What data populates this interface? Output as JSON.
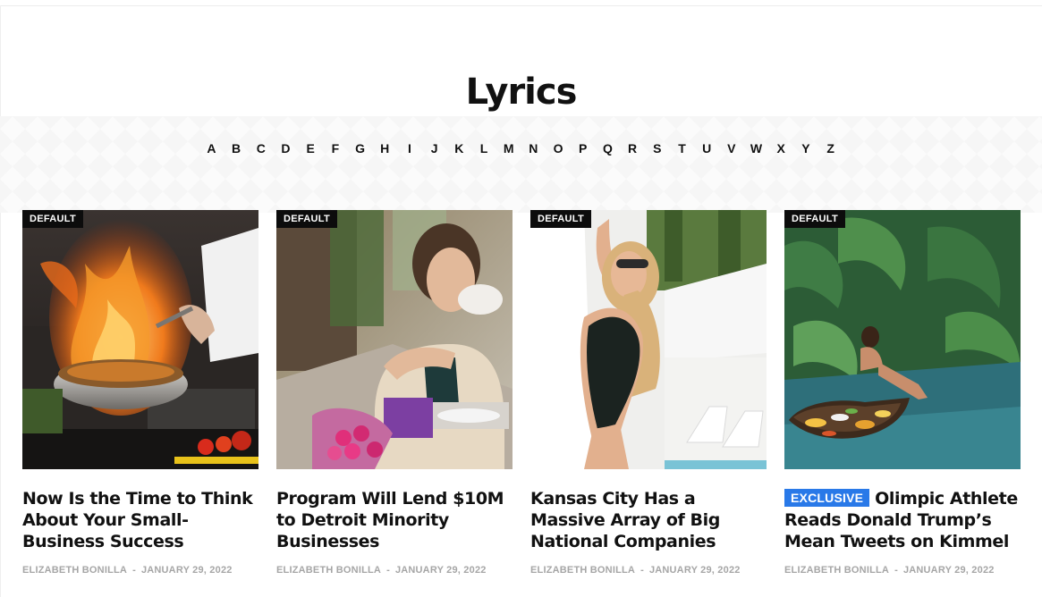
{
  "page": {
    "title": "Lyrics"
  },
  "alphabet": [
    "A",
    "B",
    "C",
    "D",
    "E",
    "F",
    "G",
    "H",
    "I",
    "J",
    "K",
    "L",
    "M",
    "N",
    "O",
    "P",
    "Q",
    "R",
    "S",
    "T",
    "U",
    "V",
    "W",
    "X",
    "Y",
    "Z"
  ],
  "cards": [
    {
      "badge": "DEFAULT",
      "title": "Now Is the Time to Think About Your Small-Business Success",
      "author": "ELIZABETH BONILLA",
      "separator": "-",
      "date": "JANUARY 29, 2022"
    },
    {
      "badge": "DEFAULT",
      "title": "Program Will Lend $10M to Detroit Minority Businesses",
      "author": "ELIZABETH BONILLA",
      "separator": "-",
      "date": "JANUARY 29, 2022"
    },
    {
      "badge": "DEFAULT",
      "title": "Kansas City Has a Massive Array of Big National Companies",
      "author": "ELIZABETH BONILLA",
      "separator": "-",
      "date": "JANUARY 29, 2022"
    },
    {
      "badge": "DEFAULT",
      "label": "EXCLUSIVE",
      "title": "Olimpic Athlete Reads Donald Trump’s Mean Tweets on Kimmel",
      "author": "ELIZABETH BONILLA",
      "separator": "-",
      "date": "JANUARY 29, 2022"
    }
  ],
  "colors": {
    "exclusive_label": "#2979e8",
    "badge_bg": "#0c0c0c",
    "meta_text": "#a6a6a6"
  }
}
